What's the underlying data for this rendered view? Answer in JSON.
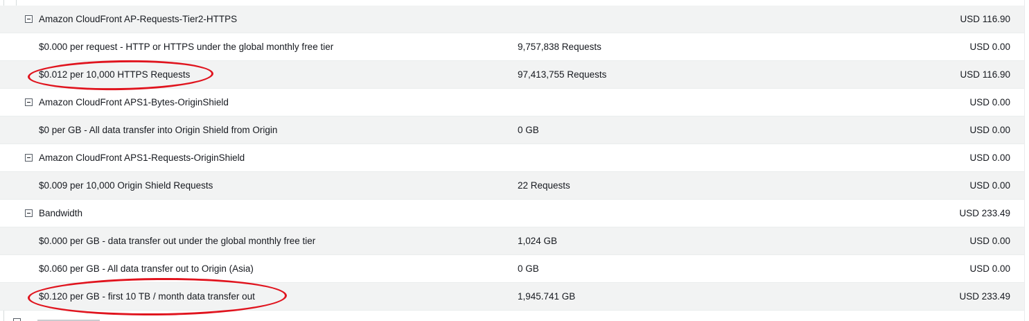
{
  "rows": [
    {
      "kind": "group",
      "label": "Amazon CloudFront AP-Requests-Tier2-HTTPS",
      "quantity": "",
      "amount": "USD 116.90"
    },
    {
      "kind": "item",
      "label": "$0.000 per request - HTTP or HTTPS under the global monthly free tier",
      "quantity": "9,757,838 Requests",
      "amount": "USD 0.00"
    },
    {
      "kind": "item",
      "label": "$0.012 per 10,000 HTTPS Requests",
      "quantity": "97,413,755 Requests",
      "amount": "USD 116.90"
    },
    {
      "kind": "group",
      "label": "Amazon CloudFront APS1-Bytes-OriginShield",
      "quantity": "",
      "amount": "USD 0.00"
    },
    {
      "kind": "item",
      "label": "$0 per GB - All data transfer into Origin Shield from Origin",
      "quantity": "0 GB",
      "amount": "USD 0.00"
    },
    {
      "kind": "group",
      "label": "Amazon CloudFront APS1-Requests-OriginShield",
      "quantity": "",
      "amount": "USD 0.00"
    },
    {
      "kind": "item",
      "label": "$0.009 per 10,000 Origin Shield Requests",
      "quantity": "22 Requests",
      "amount": "USD 0.00"
    },
    {
      "kind": "group",
      "label": "Bandwidth",
      "quantity": "",
      "amount": "USD 233.49"
    },
    {
      "kind": "item",
      "label": "$0.000 per GB - data transfer out under the global monthly free tier",
      "quantity": "1,024 GB",
      "amount": "USD 0.00"
    },
    {
      "kind": "item",
      "label": "$0.060 per GB - All data transfer out to Origin (Asia)",
      "quantity": "0 GB",
      "amount": "USD 0.00"
    },
    {
      "kind": "item",
      "label": "$0.120 per GB - first 10 TB / month data transfer out",
      "quantity": "1,945.741 GB",
      "amount": "USD 233.49"
    }
  ],
  "colors": {
    "row_gray": "#f2f3f3",
    "highlight": "#e0141e"
  }
}
